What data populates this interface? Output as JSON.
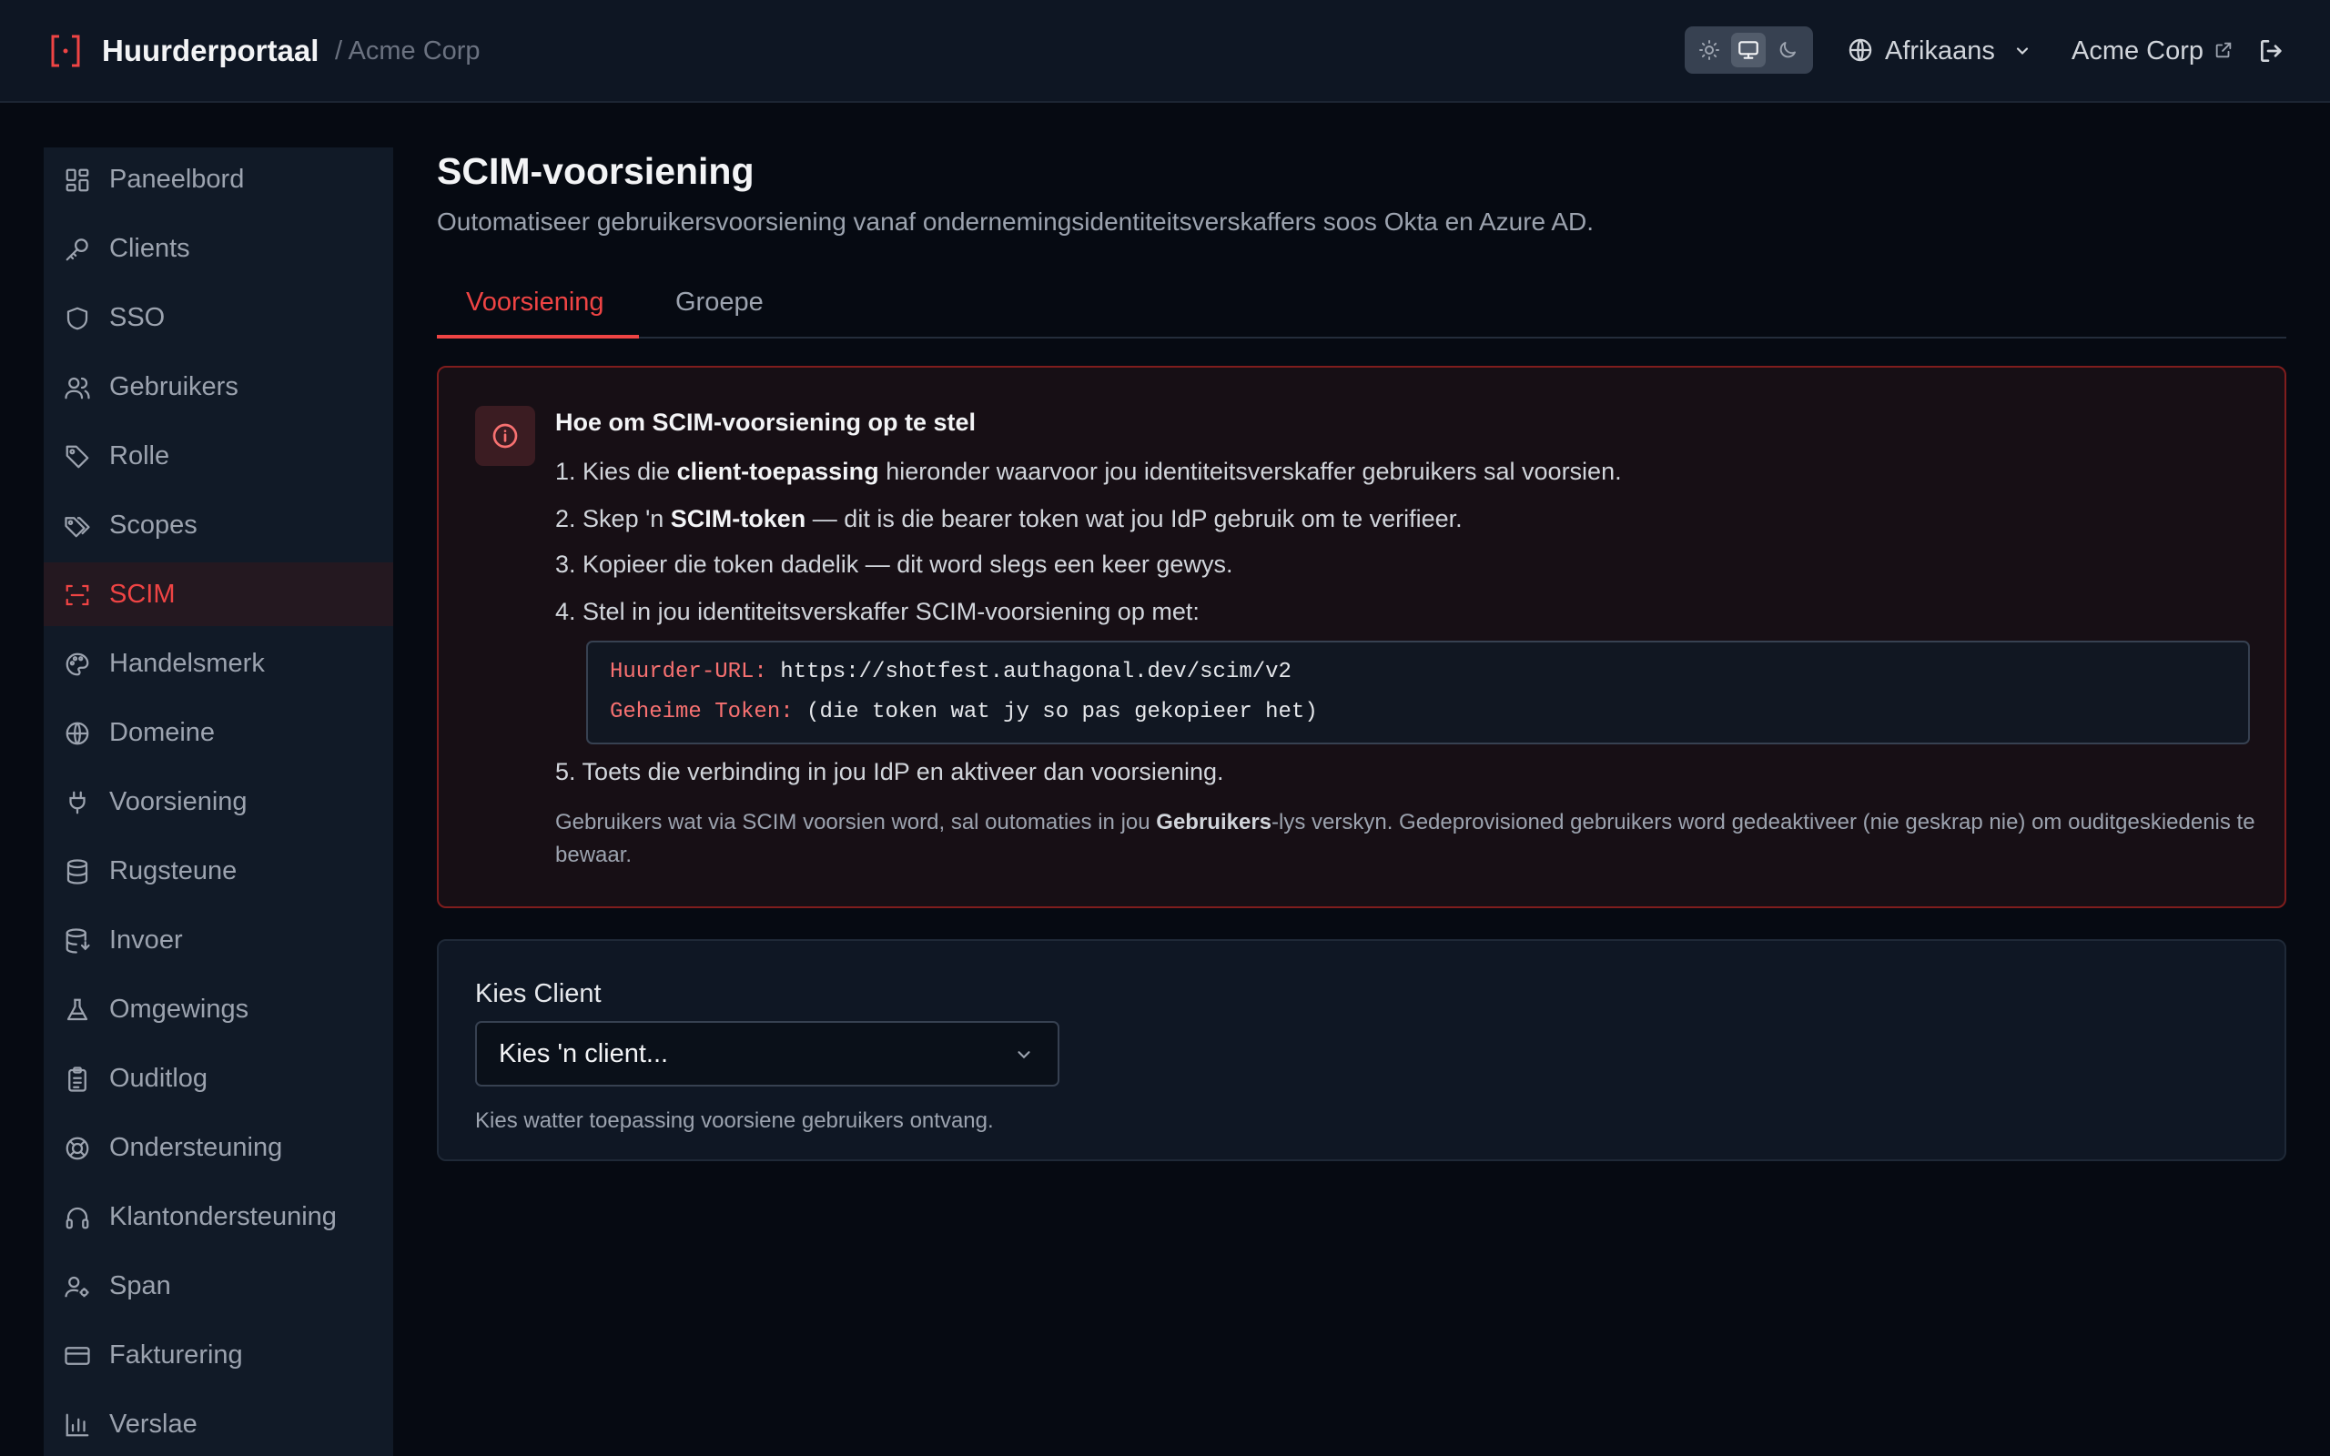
{
  "header": {
    "app_name": "Huurderportaal",
    "tenant_crumb": "/ Acme Corp",
    "language": "Afrikaans",
    "tenant_name": "Acme Corp",
    "theme_options": [
      "sun-icon",
      "monitor-icon",
      "moon-icon"
    ],
    "theme_selected": "monitor-icon"
  },
  "sidebar": {
    "active": "SCIM",
    "items": [
      {
        "label": "Paneelbord",
        "icon": "dashboard-icon"
      },
      {
        "label": "Clients",
        "icon": "key-icon"
      },
      {
        "label": "SSO",
        "icon": "shield-icon"
      },
      {
        "label": "Gebruikers",
        "icon": "users-icon"
      },
      {
        "label": "Rolle",
        "icon": "tag-icon"
      },
      {
        "label": "Scopes",
        "icon": "tags-icon"
      },
      {
        "label": "SCIM",
        "icon": "scan-icon"
      },
      {
        "label": "Handelsmerk",
        "icon": "palette-icon"
      },
      {
        "label": "Domeine",
        "icon": "globe-icon"
      },
      {
        "label": "Voorsiening",
        "icon": "plug-icon"
      },
      {
        "label": "Rugsteune",
        "icon": "database-icon"
      },
      {
        "label": "Invoer",
        "icon": "database-import-icon"
      },
      {
        "label": "Omgewings",
        "icon": "flask-icon"
      },
      {
        "label": "Ouditlog",
        "icon": "clipboard-icon"
      },
      {
        "label": "Ondersteuning",
        "icon": "lifebuoy-icon"
      },
      {
        "label": "Klantondersteuning",
        "icon": "headphones-icon"
      },
      {
        "label": "Span",
        "icon": "user-cog-icon"
      },
      {
        "label": "Fakturering",
        "icon": "credit-card-icon"
      },
      {
        "label": "Verslae",
        "icon": "bar-chart-icon"
      }
    ]
  },
  "page": {
    "title": "SCIM-voorsiening",
    "subtitle": "Outomatiseer gebruikersvoorsiening vanaf ondernemingsidentiteitsverskaffers soos Okta en Azure AD."
  },
  "tabs": [
    {
      "label": "Voorsiening",
      "active": true
    },
    {
      "label": "Groepe",
      "active": false
    }
  ],
  "info": {
    "heading": "Hoe om SCIM-voorsiening op te stel",
    "step1": {
      "n": "1.",
      "pre": "Kies die",
      "bold": "client-toepassing",
      "post": "hieronder waarvoor jou identiteitsverskaffer gebruikers sal voorsien."
    },
    "step2": {
      "n": "2.",
      "pre": "Skep 'n",
      "bold": "SCIM-token",
      "post": "— dit is die bearer token wat jou IdP gebruik om te verifieer."
    },
    "step3": {
      "n": "3.",
      "text": "Kopieer die token dadelik — dit word slegs een keer gewys."
    },
    "step4": {
      "n": "4.",
      "text": "Stel in jou identiteitsverskaffer SCIM-voorsiening op met:"
    },
    "code": {
      "url_key": "Huurder-URL:",
      "url_value": "https://shotfest.authagonal.dev/scim/v2",
      "token_key": "Geheime Token:",
      "token_value": "(die token wat jy so pas gekopieer het)"
    },
    "step5": {
      "n": "5.",
      "text": "Toets die verbinding in jou IdP en aktiveer dan voorsiening."
    },
    "note": {
      "pre": "Gebruikers wat via SCIM voorsien word, sal outomaties in jou",
      "bold": "Gebruikers",
      "post": "-lys verskyn. Gedeprovisioned gebruikers word gedeaktiveer (nie geskrap nie) om ouditgeskiedenis te bewaar."
    }
  },
  "client_picker": {
    "label": "Kies Client",
    "value": "Kies 'n client...",
    "help": "Kies watter toepassing voorsiene gebruikers ontvang."
  },
  "colors": {
    "accent": "#ef4444",
    "background": "#060a12",
    "sidebar": "#111a27",
    "info_border": "#7f1d1d"
  }
}
